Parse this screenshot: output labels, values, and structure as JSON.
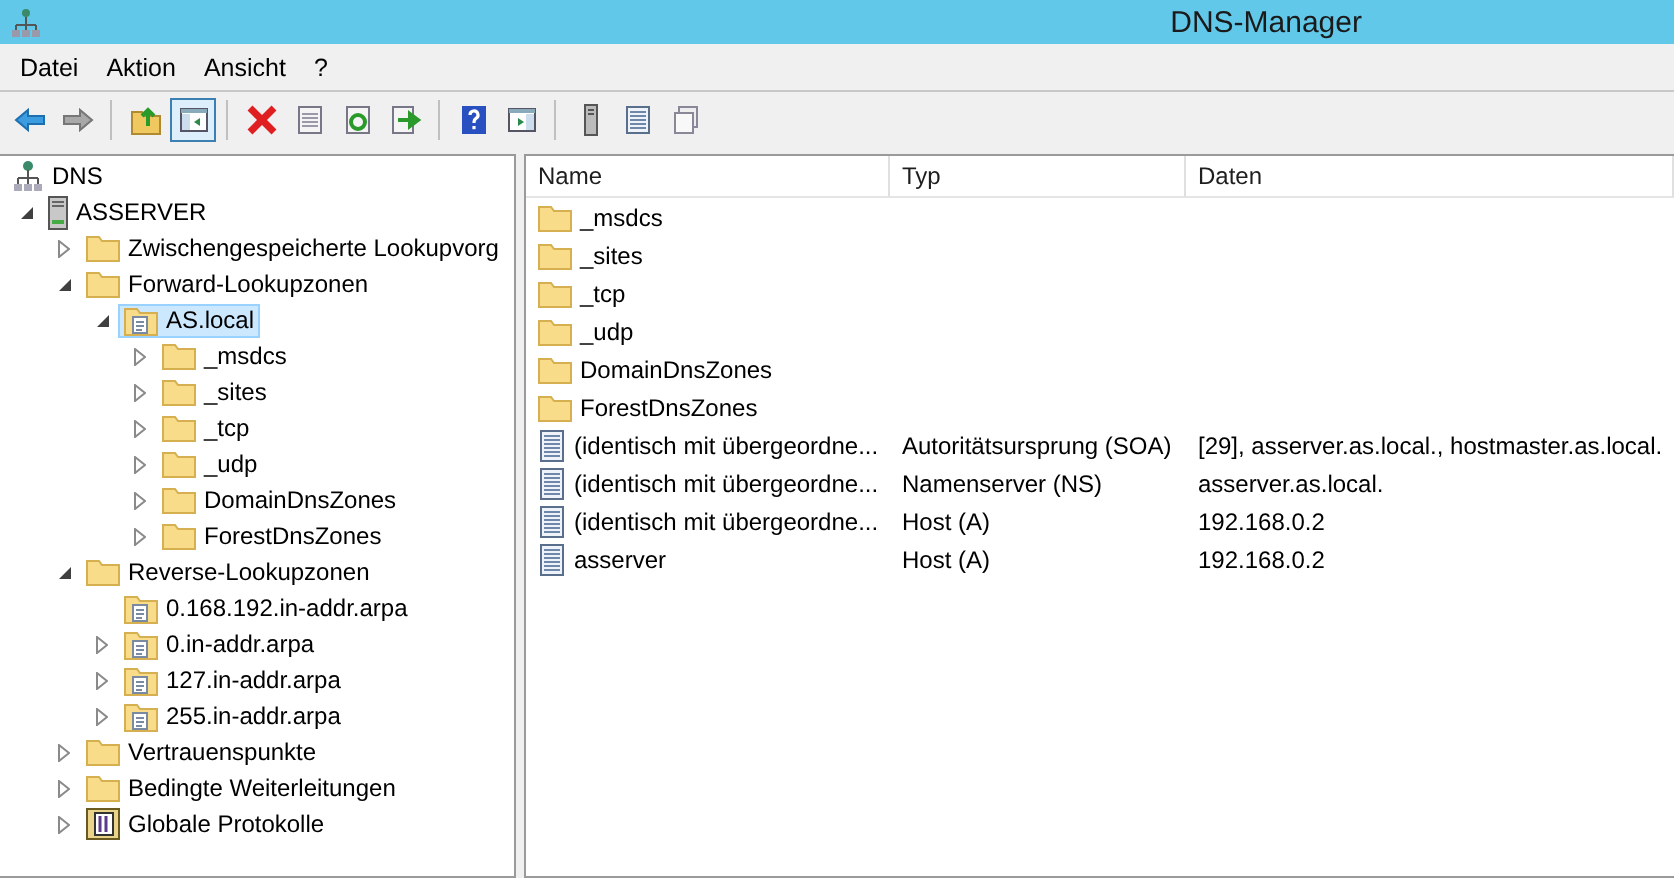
{
  "window": {
    "title": "DNS-Manager"
  },
  "menu": [
    "Datei",
    "Aktion",
    "Ansicht",
    "?"
  ],
  "toolbar": {
    "groups": [
      [
        {
          "pressed": false,
          "disabled": false
        },
        {
          "pressed": false,
          "disabled": true
        }
      ],
      [
        {
          "pressed": false,
          "disabled": false
        },
        {
          "pressed": true,
          "disabled": false
        }
      ],
      [
        {
          "pressed": false,
          "disabled": false
        },
        {
          "pressed": false,
          "disabled": false
        },
        {
          "pressed": false,
          "disabled": false
        },
        {
          "pressed": false,
          "disabled": false
        }
      ],
      [
        {
          "pressed": false,
          "disabled": false
        },
        {
          "pressed": false,
          "disabled": false
        }
      ],
      [
        {
          "pressed": false,
          "disabled": false
        },
        {
          "pressed": false,
          "disabled": false
        },
        {
          "pressed": false,
          "disabled": false
        }
      ]
    ]
  },
  "tree": [
    {
      "label": "DNS",
      "kind": "dns",
      "selected": false,
      "children": [
        {
          "label": "ASSERVER",
          "kind": "server",
          "expanded": true,
          "selected": false,
          "children": [
            {
              "label": "Zwischengespeicherte Lookupvorg",
              "kind": "folder",
              "expanded": false,
              "selected": false
            },
            {
              "label": "Forward-Lookupzonen",
              "kind": "folder",
              "expanded": true,
              "selected": false,
              "children": [
                {
                  "label": "AS.local",
                  "kind": "zone",
                  "expanded": true,
                  "selected": true,
                  "children": [
                    {
                      "label": "_msdcs",
                      "kind": "folder",
                      "expanded": false,
                      "selected": false
                    },
                    {
                      "label": "_sites",
                      "kind": "folder",
                      "expanded": false,
                      "selected": false
                    },
                    {
                      "label": "_tcp",
                      "kind": "folder",
                      "expanded": false,
                      "selected": false
                    },
                    {
                      "label": "_udp",
                      "kind": "folder",
                      "expanded": false,
                      "selected": false
                    },
                    {
                      "label": "DomainDnsZones",
                      "kind": "folder",
                      "expanded": false,
                      "selected": false
                    },
                    {
                      "label": "ForestDnsZones",
                      "kind": "folder",
                      "expanded": false,
                      "selected": false
                    }
                  ]
                }
              ]
            },
            {
              "label": "Reverse-Lookupzonen",
              "kind": "folder",
              "expanded": true,
              "selected": false,
              "children": [
                {
                  "label": "0.168.192.in-addr.arpa",
                  "kind": "zone",
                  "selected": false
                },
                {
                  "label": "0.in-addr.arpa",
                  "kind": "zone",
                  "expanded": false,
                  "selected": false
                },
                {
                  "label": "127.in-addr.arpa",
                  "kind": "zone",
                  "expanded": false,
                  "selected": false
                },
                {
                  "label": "255.in-addr.arpa",
                  "kind": "zone",
                  "expanded": false,
                  "selected": false
                }
              ]
            },
            {
              "label": "Vertrauenspunkte",
              "kind": "folder",
              "expanded": false,
              "selected": false
            },
            {
              "label": "Bedingte Weiterleitungen",
              "kind": "folder",
              "expanded": false,
              "selected": false
            },
            {
              "label": "Globale Protokolle",
              "kind": "log",
              "expanded": false,
              "selected": false
            }
          ]
        }
      ]
    }
  ],
  "table": {
    "columns": [
      "Name",
      "Typ",
      "Daten"
    ],
    "rows": [
      {
        "kind": "folder",
        "name": "_msdcs"
      },
      {
        "kind": "folder",
        "name": "_sites"
      },
      {
        "kind": "folder",
        "name": "_tcp"
      },
      {
        "kind": "folder",
        "name": "_udp"
      },
      {
        "kind": "folder",
        "name": "DomainDnsZones"
      },
      {
        "kind": "folder",
        "name": "ForestDnsZones"
      },
      {
        "kind": "record",
        "name": "(identisch mit übergeordne...",
        "type": "Autoritätsursprung (SOA)",
        "data": "[29], asserver.as.local., hostmaster.as.local."
      },
      {
        "kind": "record",
        "name": "(identisch mit übergeordne...",
        "type": "Namenserver (NS)",
        "data": "asserver.as.local."
      },
      {
        "kind": "record",
        "name": "(identisch mit übergeordne...",
        "type": "Host (A)",
        "data": "192.168.0.2"
      },
      {
        "kind": "record",
        "name": "asserver",
        "type": "Host (A)",
        "data": "192.168.0.2"
      }
    ]
  }
}
